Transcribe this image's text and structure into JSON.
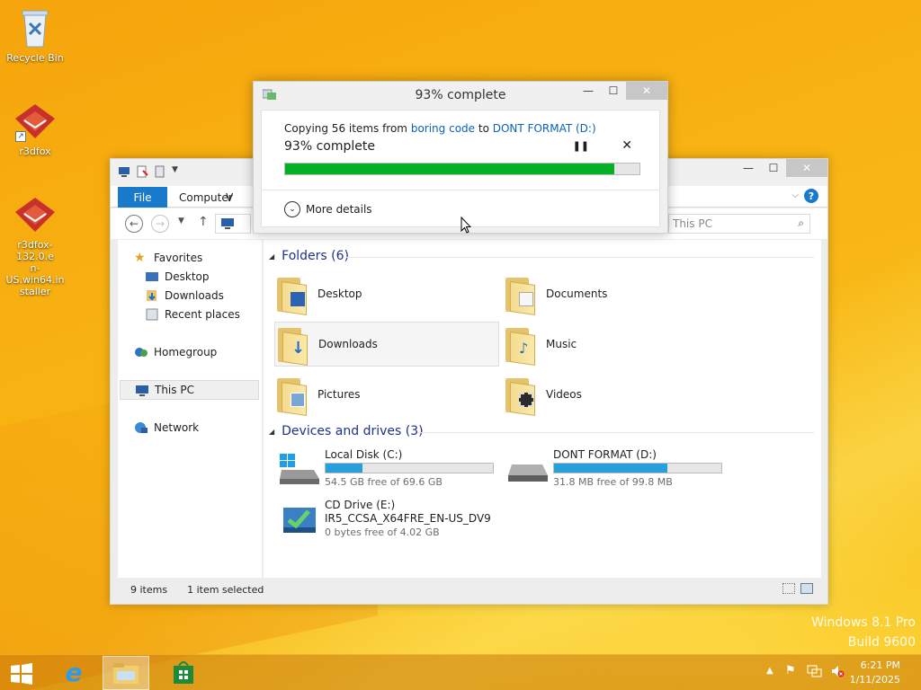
{
  "desktop": {
    "icons": [
      {
        "label": "Recycle Bin"
      },
      {
        "label": "r3dfox"
      },
      {
        "label": "r3dfox-132.0.en-US.win64.installer",
        "lines": [
          "r3dfox-132.0.e",
          "n-US.win64.in",
          "staller"
        ]
      }
    ],
    "watermark": {
      "line1": "Windows 8.1 Pro",
      "line2": "Build 9600"
    }
  },
  "progress_dialog": {
    "title": "93% complete",
    "copy_prefix": "Copying 56 items from",
    "source": "boring code",
    "to_word": "to",
    "destination": "DONT FORMAT (D:)",
    "status": "93% complete",
    "progress_percent": 93,
    "pause_glyph": "❚❚",
    "cancel_glyph": "✕",
    "more_details": "More details"
  },
  "explorer": {
    "tabs": {
      "file": "File",
      "computer": "Computer",
      "view": "V"
    },
    "search_placeholder": "This PC",
    "nav_pane": {
      "favorites": "Favorites",
      "desktop": "Desktop",
      "downloads": "Downloads",
      "recent": "Recent places",
      "homegroup": "Homegroup",
      "this_pc": "This PC",
      "network": "Network"
    },
    "folders_header": "Folders (6)",
    "folders": [
      {
        "name": "Desktop"
      },
      {
        "name": "Documents"
      },
      {
        "name": "Downloads"
      },
      {
        "name": "Music"
      },
      {
        "name": "Pictures"
      },
      {
        "name": "Videos"
      }
    ],
    "drives_header": "Devices and drives (3)",
    "drives": [
      {
        "name": "Local Disk (C:)",
        "free": "54.5 GB free of 69.6 GB",
        "used_fraction": 0.22
      },
      {
        "name": "DONT FORMAT (D:)",
        "free": "31.8 MB free of 99.8 MB",
        "used_fraction": 0.68
      },
      {
        "name": "CD Drive (E:)",
        "label": "IR5_CCSA_X64FRE_EN-US_DV9",
        "free": "0 bytes free of 4.02 GB"
      }
    ],
    "status": {
      "items": "9 items",
      "selected": "1 item selected"
    }
  },
  "taskbar": {
    "clock_time": "6:21 PM",
    "clock_date": "1/11/2025"
  }
}
